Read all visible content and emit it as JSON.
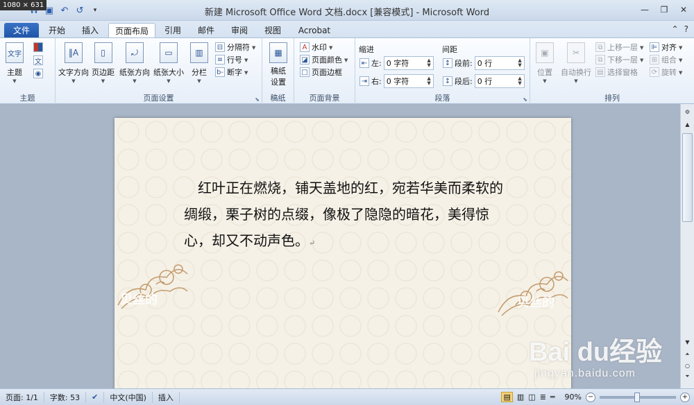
{
  "overlay": {
    "dim_tag": "1080 × 631"
  },
  "titlebar": {
    "title": "新建 Microsoft Office Word 文档.docx [兼容模式] - Microsoft Word"
  },
  "tabs": {
    "file": "文件",
    "items": [
      "开始",
      "插入",
      "页面布局",
      "引用",
      "邮件",
      "审阅",
      "视图",
      "Acrobat"
    ],
    "active": "页面布局"
  },
  "ribbon": {
    "theme_group": {
      "label": "主题",
      "theme_button": "主题",
      "big_icon": "文字"
    },
    "page_setup": {
      "label": "页面设置",
      "text_direction": "文字方向",
      "margins": "页边距",
      "orientation": "纸张方向",
      "size": "纸张大小",
      "columns": "分栏",
      "breaks": "分隔符",
      "line_numbers": "行号",
      "hyphenation": "断字"
    },
    "manuscript": {
      "label": "稿纸",
      "button_line1": "稿纸",
      "button_line2": "设置"
    },
    "page_background": {
      "label": "页面背景",
      "watermark": "水印",
      "page_color": "页面颜色",
      "page_border": "页面边框"
    },
    "paragraph": {
      "label": "段落",
      "indent_title": "缩进",
      "spacing_title": "间距",
      "left_label": "左:",
      "left_value": "0 字符",
      "right_label": "右:",
      "right_value": "0 字符",
      "before_label": "段前:",
      "before_value": "0 行",
      "after_label": "段后:",
      "after_value": "0 行"
    },
    "arrange": {
      "label": "排列",
      "position": "位置",
      "wrap_text": "自动换行",
      "bring_forward": "上移一层",
      "send_backward": "下移一层",
      "selection_pane": "选择窗格",
      "align": "对齐",
      "group": "组合",
      "rotate": "旋转"
    }
  },
  "document": {
    "paragraph": "红叶正在燃烧，铺天盖地的红，宛若华美而柔软的绸缎，栗子树的点缀，像极了隐隐的暗花，美得惊心，却又不动声色。",
    "return_mark": "↵",
    "corner_watermark": "贝丝的"
  },
  "statusbar": {
    "page": "页面: 1/1",
    "words": "字数: 53",
    "language": "中文(中国)",
    "mode": "插入",
    "zoom": "90%"
  },
  "watermark": {
    "logo": "Bai du经验",
    "url": "jingyan.baidu.com"
  }
}
